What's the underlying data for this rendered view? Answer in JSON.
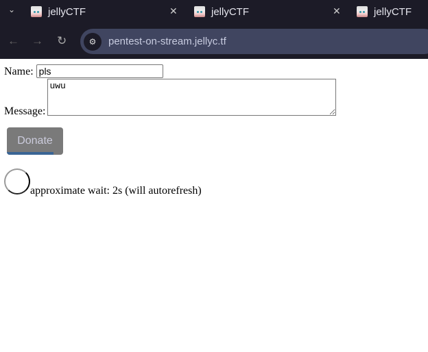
{
  "browser": {
    "tabs": [
      {
        "title": "jellyCTF"
      },
      {
        "title": "jellyCTF"
      },
      {
        "title": "jellyCTF"
      }
    ],
    "url": "pentest-on-stream.jellyc.tf"
  },
  "form": {
    "name_label": "Name:",
    "name_value": "pls",
    "message_label": "Message:",
    "message_value": "uwu",
    "donate_label": "Donate",
    "donate_progress": 0.83,
    "progress_color": "#3a6595"
  },
  "status": {
    "wait_text": "approximate wait: 2s (will autorefresh)"
  }
}
